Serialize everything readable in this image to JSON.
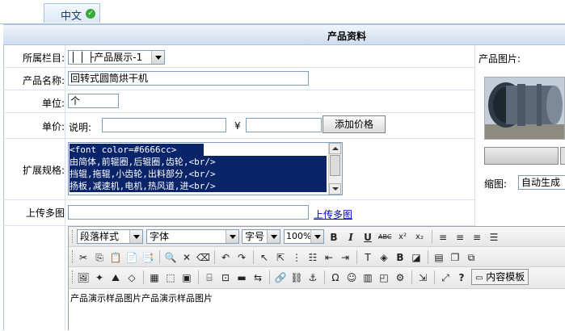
{
  "language_tab": {
    "label": "中文"
  },
  "section_title": "产品资料",
  "fields": {
    "category": {
      "label": "所属栏目:",
      "value": "│ │ ├产品展示-1"
    },
    "name": {
      "label": "产品名称:",
      "value": "回转式圆筒烘干机"
    },
    "unit": {
      "label": "单位:",
      "value": "个"
    },
    "price": {
      "label": "单价:",
      "desc_label": "说明:",
      "desc_value": "",
      "currency": "¥",
      "price_value": "",
      "add_button": "添加价格"
    },
    "spec": {
      "label": "扩展规格:",
      "lines": [
        "<font color=#6666cc>",
        "由简体,前辊圈,后辊圈,齿轮,<br/>",
        "挡辊,拖辊,小齿轮,出料部分,<br/>",
        "扬板,减速机,电机,热风道,进<br/>"
      ]
    },
    "multi_upload": {
      "label": "上传多图",
      "value": "",
      "link": "上传多图"
    }
  },
  "product_image": {
    "label": "产品图片:",
    "thumb_label": "缩图:",
    "thumb_select": "自动生成"
  },
  "editor": {
    "paragraph_style": "段落样式",
    "font": "字体",
    "font_size": "字号",
    "zoom": "100%",
    "template_button": "内容模板",
    "content": "产品演示样品图片产品演示样品图片"
  },
  "colors": {
    "accent": "#a9c3e0",
    "selection": "#0a246a",
    "link": "#0000cc"
  }
}
